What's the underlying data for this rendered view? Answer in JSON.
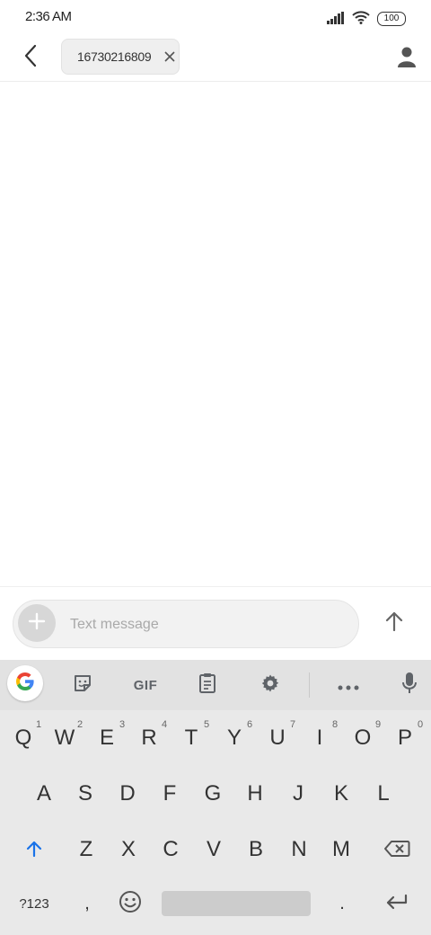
{
  "status_bar": {
    "time": "2:36 AM",
    "battery": "100",
    "icons": [
      "signal-icon",
      "wifi-icon",
      "battery-icon"
    ]
  },
  "header": {
    "recipient": "16730216809",
    "icons": [
      "back-arrow-icon",
      "close-icon",
      "contact-icon"
    ]
  },
  "compose": {
    "placeholder": "Text message",
    "icons": [
      "plus-icon",
      "send-arrow-icon"
    ]
  },
  "keyboard": {
    "toolbar": {
      "gif_label": "GIF",
      "icons": [
        "google-icon",
        "sticker-icon",
        "clipboard-icon",
        "gear-icon",
        "more-icon",
        "mic-icon"
      ]
    },
    "row1": [
      "Q",
      "W",
      "E",
      "R",
      "T",
      "Y",
      "U",
      "I",
      "O",
      "P"
    ],
    "row1_hints": [
      "1",
      "2",
      "3",
      "4",
      "5",
      "6",
      "7",
      "8",
      "9",
      "0"
    ],
    "row2": [
      "A",
      "S",
      "D",
      "F",
      "G",
      "H",
      "J",
      "K",
      "L"
    ],
    "row3": [
      "Z",
      "X",
      "C",
      "V",
      "B",
      "N",
      "M"
    ],
    "symbols_key": "?123",
    "comma_key": ",",
    "period_key": ".",
    "accent_color": "#1a73e8"
  }
}
